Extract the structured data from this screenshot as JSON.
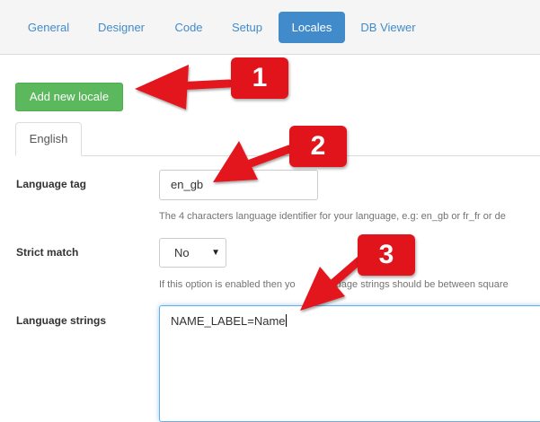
{
  "nav": {
    "tabs": [
      {
        "label": "General"
      },
      {
        "label": "Designer"
      },
      {
        "label": "Code"
      },
      {
        "label": "Setup"
      },
      {
        "label": "Locales",
        "active": true
      },
      {
        "label": "DB Viewer"
      }
    ],
    "active_color": "#428bca"
  },
  "actions": {
    "add_locale_label": "Add new locale",
    "add_locale_color": "#5cb85c"
  },
  "locale_tabs": [
    {
      "label": "English"
    }
  ],
  "form": {
    "language_tag": {
      "label": "Language tag",
      "value": "en_gb",
      "help": "The 4 characters language identifier for your language, e.g: en_gb or fr_fr or de"
    },
    "strict_match": {
      "label": "Strict match",
      "value": "No",
      "help": "If this option is enabled then yo",
      "help_tail": "uage strings should be between square"
    },
    "language_strings": {
      "label": "Language strings",
      "value": "NAME_LABEL=Name"
    }
  },
  "annotations": {
    "color": "#e2141b",
    "markers": [
      "1",
      "2",
      "3"
    ]
  },
  "icons": {
    "select_caret": "caret-down-icon"
  }
}
